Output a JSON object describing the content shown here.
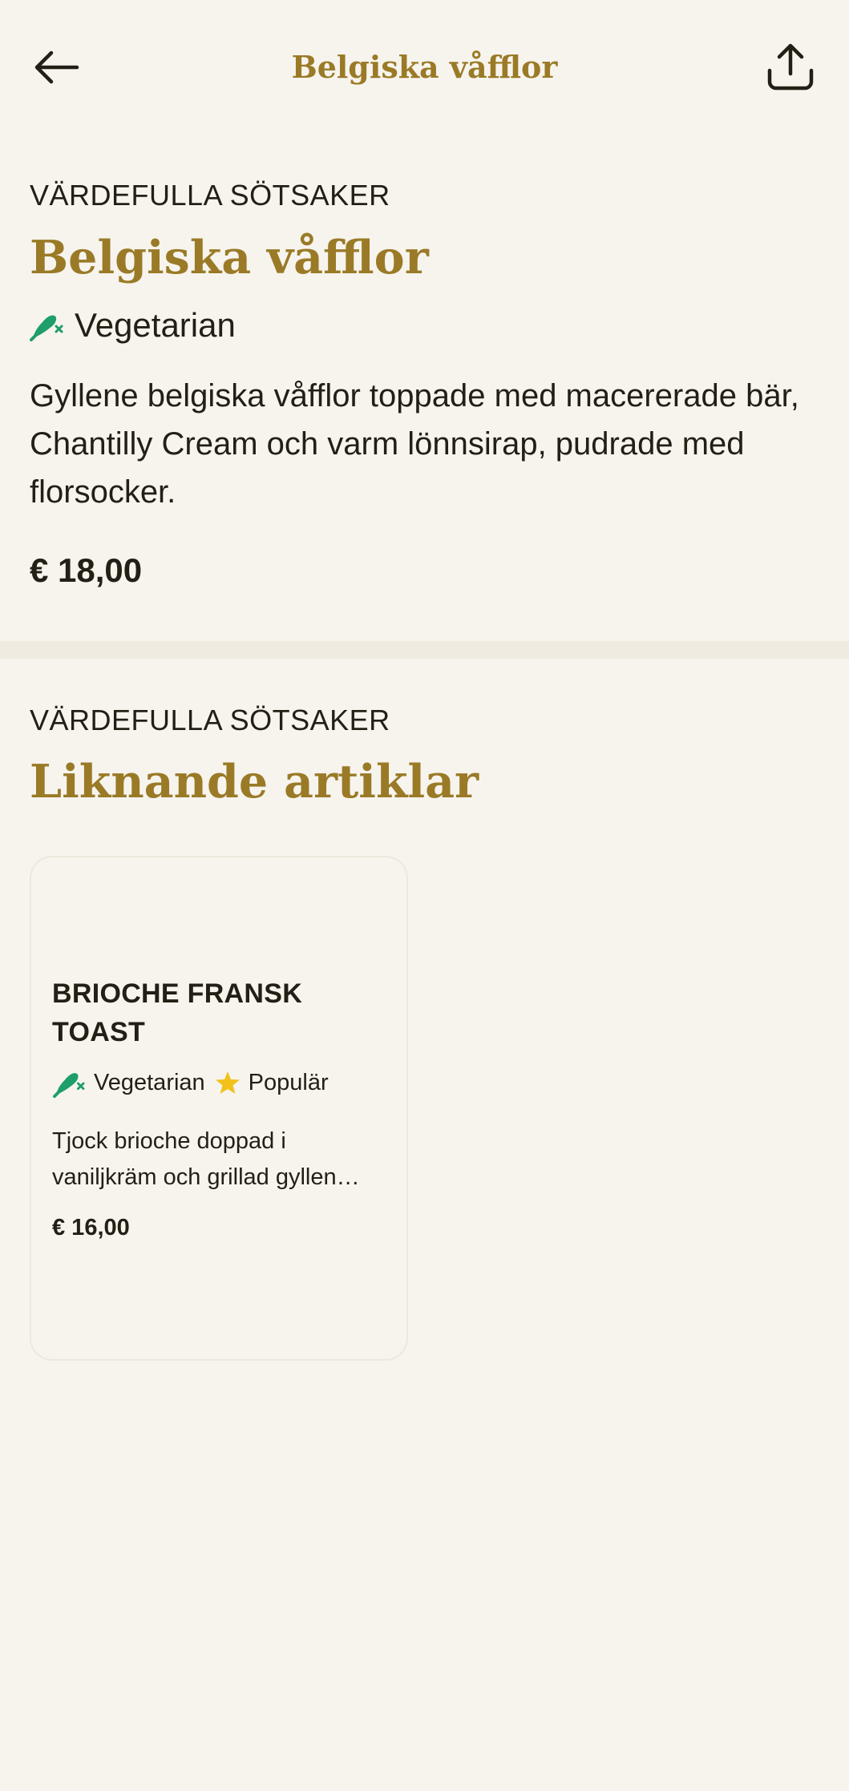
{
  "header": {
    "title": "Belgiska våfflor",
    "back_icon": "arrow-left-icon",
    "share_icon": "share-icon"
  },
  "product": {
    "category": "VÄRDEFULLA SÖTSAKER",
    "title": "Belgiska våfflor",
    "diet_label": "Vegetarian",
    "diet_icon": "vegetarian-icon",
    "description": "Gyllene belgiska våfflor toppade med macererade bär, Chantilly Cream och varm lönnsirap, pudrade med florsocker.",
    "price": "€ 18,00"
  },
  "similar": {
    "category": "VÄRDEFULLA SÖTSAKER",
    "title": "Liknande artiklar",
    "items": [
      {
        "name": "BRIOCHE FRANSK TOAST",
        "tag1": "Vegetarian",
        "tag2": "Populär",
        "description": "Tjock brioche doppad i vaniljkräm och grillad gyllen…",
        "price": "€ 16,00"
      }
    ]
  },
  "colors": {
    "background": "#f7f4ee",
    "accent": "#9a7a26",
    "text": "#221f14",
    "vegetarian_green": "#1e9e6a",
    "star_yellow": "#f2c21b"
  }
}
